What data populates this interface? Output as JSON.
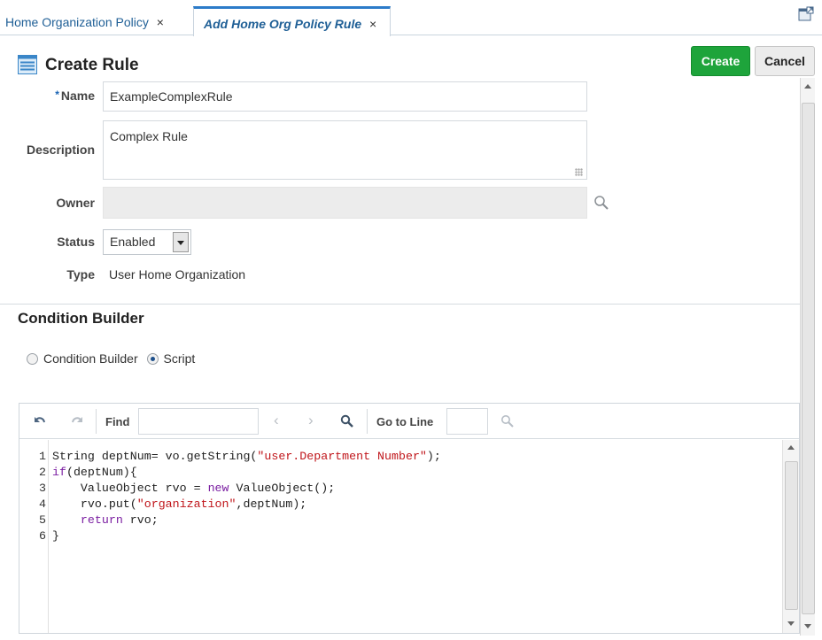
{
  "tabs": [
    {
      "label": "Home Organization Policy",
      "close": "×"
    },
    {
      "label": "Add Home Org Policy Rule",
      "close": "×"
    }
  ],
  "header": {
    "title": "Create Rule",
    "create_label": "Create",
    "cancel_label": "Cancel"
  },
  "form": {
    "required_mark": "*",
    "name_label": "Name",
    "name_value": "ExampleComplexRule",
    "description_label": "Description",
    "description_value": "Complex Rule",
    "owner_label": "Owner",
    "owner_value": "",
    "status_label": "Status",
    "status_value": "Enabled",
    "type_label": "Type",
    "type_value": "User Home Organization"
  },
  "condition": {
    "section_title": "Condition Builder",
    "option_builder": "Condition Builder",
    "option_script": "Script",
    "selected": "Script"
  },
  "editor": {
    "find_label": "Find",
    "find_value": "",
    "goto_label": "Go to Line",
    "goto_value": "",
    "line_numbers": [
      "1",
      "2",
      "3",
      "4",
      "5",
      "6"
    ]
  },
  "colors": {
    "create_button": "#1ea43b",
    "active_tab_accent": "#2c7bc9",
    "keyword": "#7b1fa2",
    "string": "#c0161b"
  }
}
